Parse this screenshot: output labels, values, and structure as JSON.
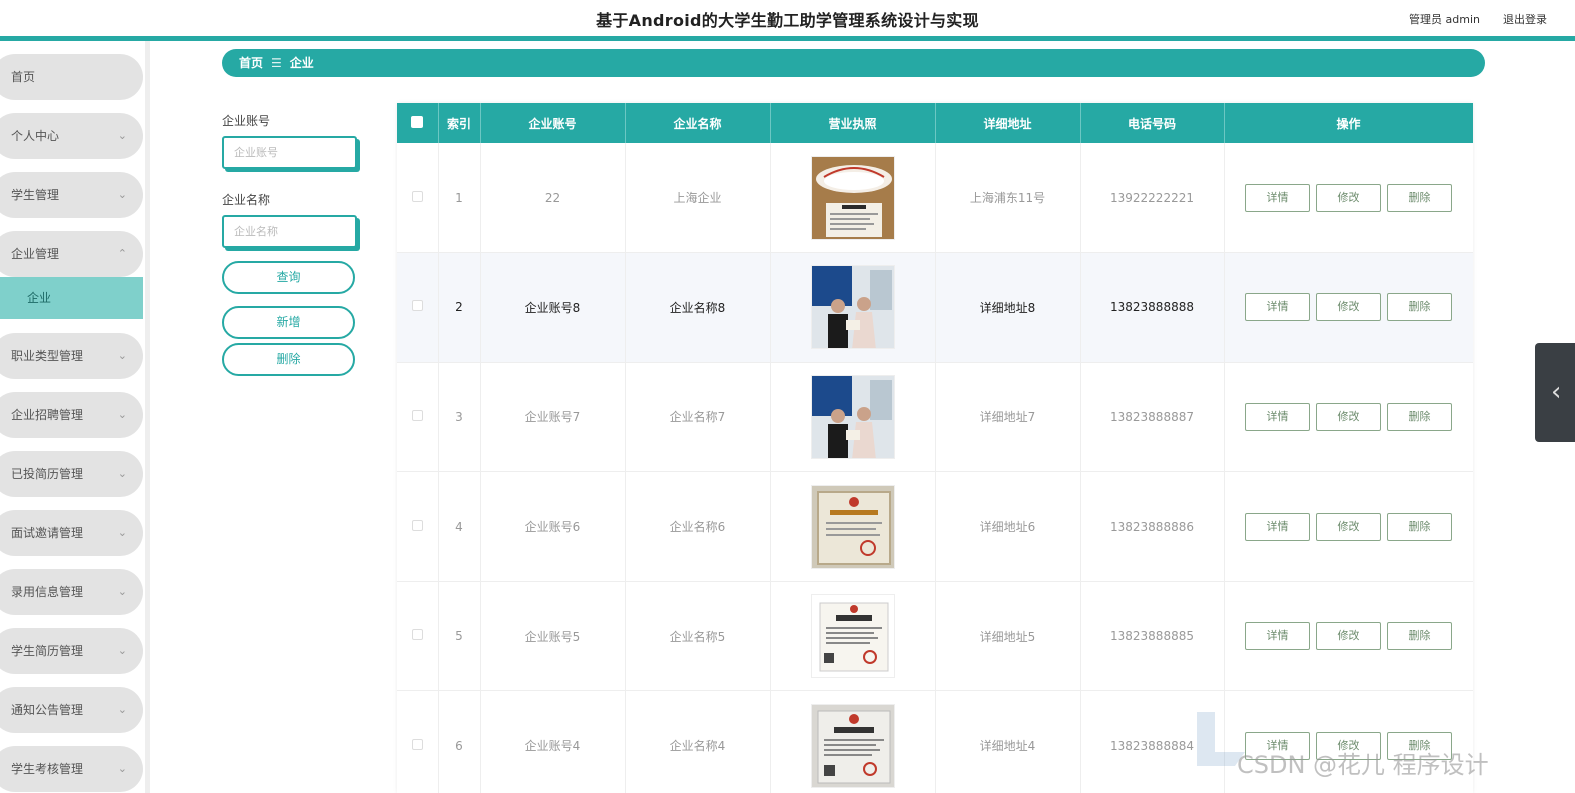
{
  "header": {
    "title": "基于Android的大学生勤工助学管理系统设计与实现",
    "user": "管理员 admin",
    "logout": "退出登录"
  },
  "sidebar": {
    "items": [
      {
        "label": "首页",
        "chevron": ""
      },
      {
        "label": "个人中心",
        "chevron": "⌄"
      },
      {
        "label": "学生管理",
        "chevron": "⌄"
      },
      {
        "label": "企业管理",
        "chevron": "⌃"
      },
      {
        "label": "职业类型管理",
        "chevron": "⌄"
      },
      {
        "label": "企业招聘管理",
        "chevron": "⌄"
      },
      {
        "label": "已投简历管理",
        "chevron": "⌄"
      },
      {
        "label": "面试邀请管理",
        "chevron": "⌄"
      },
      {
        "label": "录用信息管理",
        "chevron": "⌄"
      },
      {
        "label": "学生简历管理",
        "chevron": "⌄"
      },
      {
        "label": "通知公告管理",
        "chevron": "⌄"
      },
      {
        "label": "学生考核管理",
        "chevron": "⌄"
      }
    ],
    "submenu": {
      "label": "企业"
    }
  },
  "breadcrumb": {
    "home": "首页",
    "separator": "☰",
    "current": "企业"
  },
  "search": {
    "account_label": "企业账号",
    "account_placeholder": "企业账号",
    "name_label": "企业名称",
    "name_placeholder": "企业名称",
    "query_btn": "查询",
    "add_btn": "新增",
    "delete_btn": "删除"
  },
  "table": {
    "headers": [
      "索引",
      "企业账号",
      "企业名称",
      "营业执照",
      "详细地址",
      "电话号码",
      "操作"
    ],
    "actions": {
      "detail": "详情",
      "edit": "修改",
      "delete": "删除"
    },
    "rows": [
      {
        "index": "1",
        "account": "22",
        "name": "上海企业",
        "address": "上海浦东11号",
        "phone": "13922222221",
        "image": "lamp-certificate"
      },
      {
        "index": "2",
        "account": "企业账号8",
        "name": "企业名称8",
        "address": "详细地址8",
        "phone": "13823888888",
        "image": "people-photo"
      },
      {
        "index": "3",
        "account": "企业账号7",
        "name": "企业名称7",
        "address": "详细地址7",
        "phone": "13823888887",
        "image": "people-photo"
      },
      {
        "index": "4",
        "account": "企业账号6",
        "name": "企业名称6",
        "address": "详细地址6",
        "phone": "13823888886",
        "image": "certificate"
      },
      {
        "index": "5",
        "account": "企业账号5",
        "name": "企业名称5",
        "address": "详细地址5",
        "phone": "13823888885",
        "image": "business-license"
      },
      {
        "index": "6",
        "account": "企业账号4",
        "name": "企业名称4",
        "address": "详细地址4",
        "phone": "13823888884",
        "image": "business-license"
      }
    ]
  },
  "watermark": "CSDN @花儿 程序设计",
  "colors": {
    "accent": "#26a9a4",
    "submenu": "#7fd0cb",
    "action_border": "#8aa78a"
  }
}
